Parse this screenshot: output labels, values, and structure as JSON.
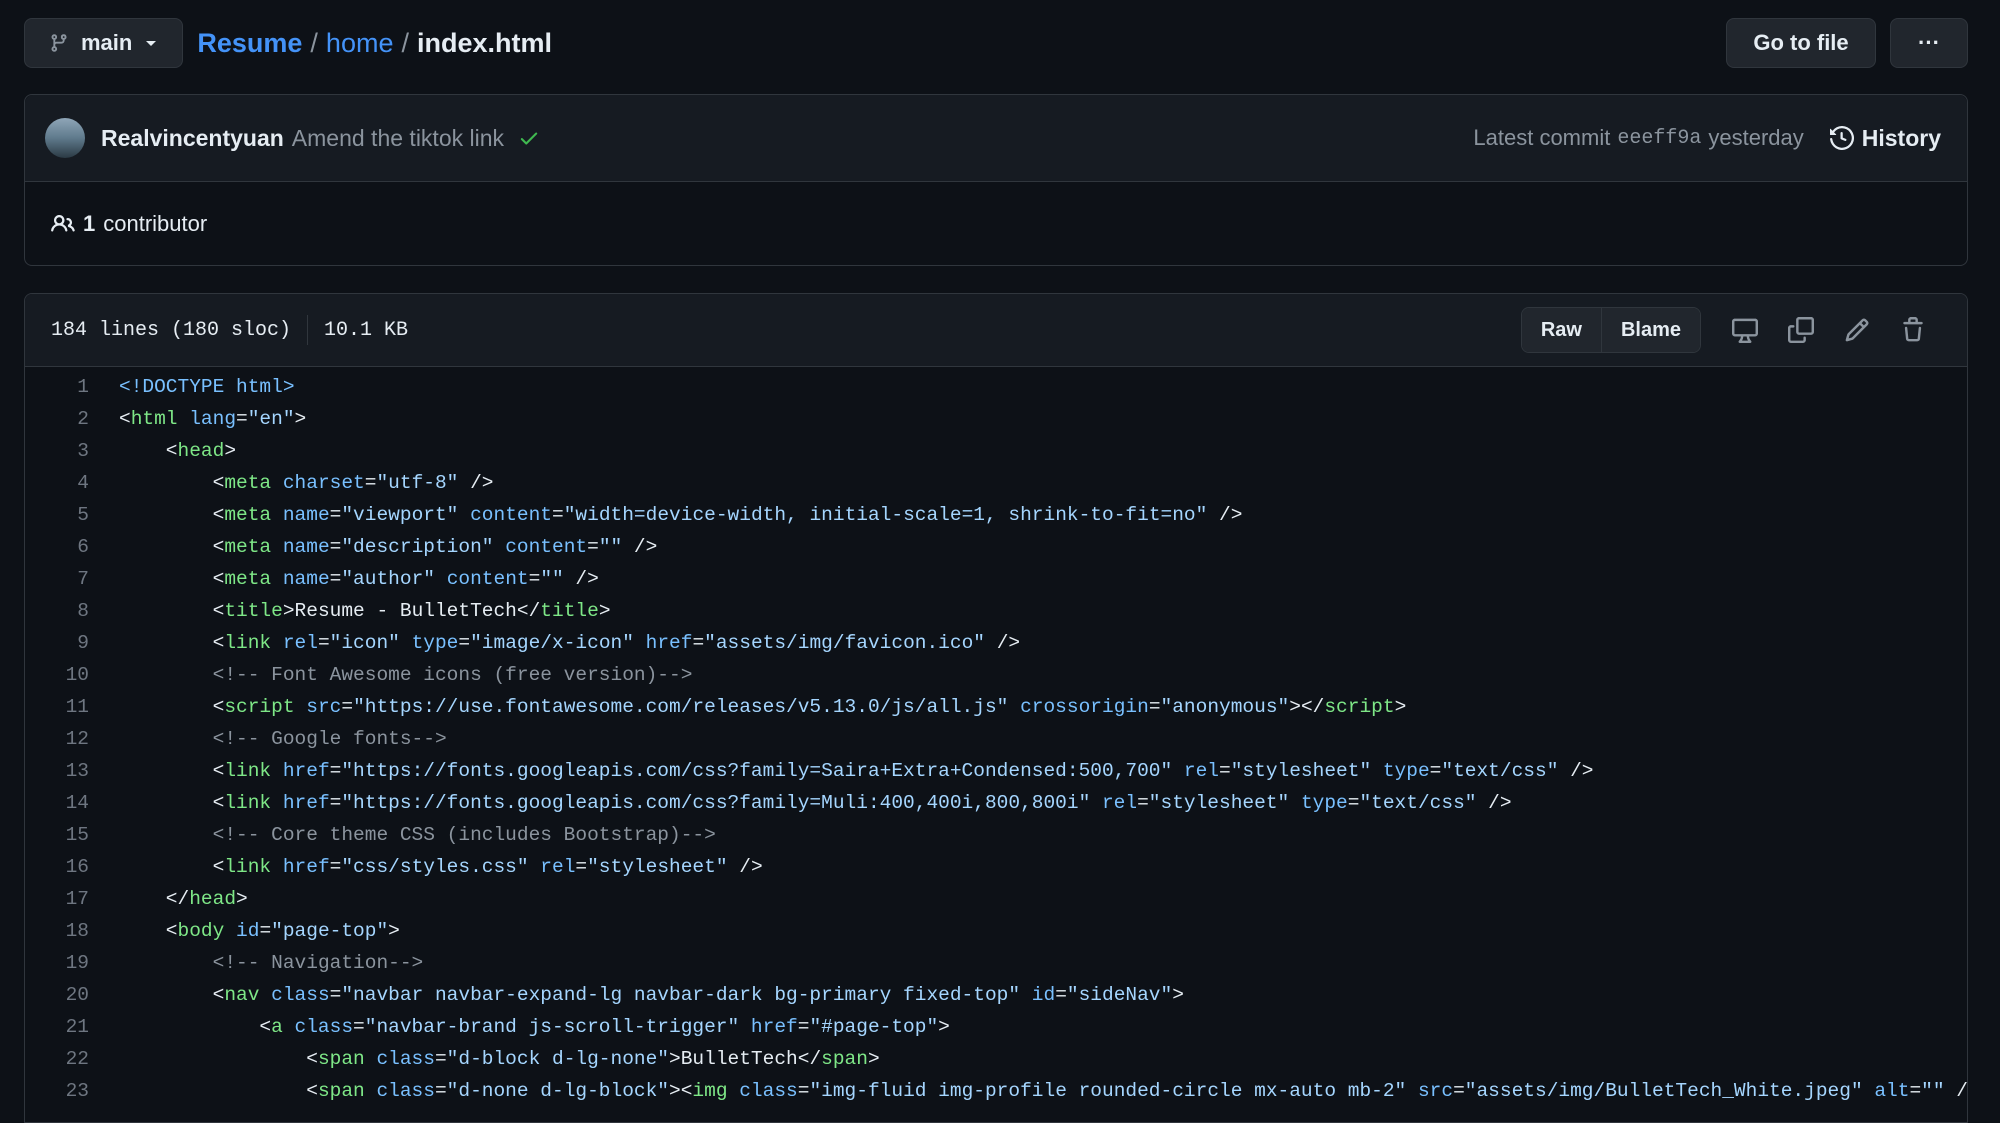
{
  "branch": {
    "name": "main"
  },
  "breadcrumb": {
    "repo": "Resume",
    "sep1": "/",
    "folder": "home",
    "sep2": "/",
    "file": "index.html"
  },
  "buttons": {
    "goto": "Go to file",
    "more": "···"
  },
  "commit": {
    "author": "Realvincentyuan",
    "message": "Amend the tiktok link",
    "status": "✓",
    "latest_label": "Latest commit",
    "sha": "eeeff9a",
    "time": "yesterday",
    "history": "History"
  },
  "contributors": {
    "count": "1",
    "label": "contributor"
  },
  "file": {
    "lines": "184 lines (180 sloc)",
    "size": "10.1 KB",
    "raw": "Raw",
    "blame": "Blame"
  },
  "colors": {
    "accent": "#4493f8",
    "success": "#3fb950",
    "tag": "#7ee787",
    "attr": "#79c0ff",
    "string": "#a5d6ff",
    "comment": "#8b949e"
  },
  "code_lines": [
    {
      "n": "1",
      "t": [
        [
          "doc",
          "<!DOCTYPE html>"
        ]
      ]
    },
    {
      "n": "2",
      "t": [
        [
          "p",
          "<"
        ],
        [
          "tag",
          "html"
        ],
        [
          "p",
          " "
        ],
        [
          "attr",
          "lang"
        ],
        [
          "p",
          "="
        ],
        [
          "str",
          "\"en\""
        ],
        [
          "p",
          ">"
        ]
      ]
    },
    {
      "n": "3",
      "t": [
        [
          "p",
          "    <"
        ],
        [
          "tag",
          "head"
        ],
        [
          "p",
          ">"
        ]
      ]
    },
    {
      "n": "4",
      "t": [
        [
          "p",
          "        <"
        ],
        [
          "tag",
          "meta"
        ],
        [
          "p",
          " "
        ],
        [
          "attr",
          "charset"
        ],
        [
          "p",
          "="
        ],
        [
          "str",
          "\"utf-8\""
        ],
        [
          "p",
          " />"
        ]
      ]
    },
    {
      "n": "5",
      "t": [
        [
          "p",
          "        <"
        ],
        [
          "tag",
          "meta"
        ],
        [
          "p",
          " "
        ],
        [
          "attr",
          "name"
        ],
        [
          "p",
          "="
        ],
        [
          "str",
          "\"viewport\""
        ],
        [
          "p",
          " "
        ],
        [
          "attr",
          "content"
        ],
        [
          "p",
          "="
        ],
        [
          "str",
          "\"width=device-width, initial-scale=1, shrink-to-fit=no\""
        ],
        [
          "p",
          " />"
        ]
      ]
    },
    {
      "n": "6",
      "t": [
        [
          "p",
          "        <"
        ],
        [
          "tag",
          "meta"
        ],
        [
          "p",
          " "
        ],
        [
          "attr",
          "name"
        ],
        [
          "p",
          "="
        ],
        [
          "str",
          "\"description\""
        ],
        [
          "p",
          " "
        ],
        [
          "attr",
          "content"
        ],
        [
          "p",
          "="
        ],
        [
          "str",
          "\"\""
        ],
        [
          "p",
          " />"
        ]
      ]
    },
    {
      "n": "7",
      "t": [
        [
          "p",
          "        <"
        ],
        [
          "tag",
          "meta"
        ],
        [
          "p",
          " "
        ],
        [
          "attr",
          "name"
        ],
        [
          "p",
          "="
        ],
        [
          "str",
          "\"author\""
        ],
        [
          "p",
          " "
        ],
        [
          "attr",
          "content"
        ],
        [
          "p",
          "="
        ],
        [
          "str",
          "\"\""
        ],
        [
          "p",
          " />"
        ]
      ]
    },
    {
      "n": "8",
      "t": [
        [
          "p",
          "        <"
        ],
        [
          "tag",
          "title"
        ],
        [
          "p",
          ">Resume - BulletTech</"
        ],
        [
          "tag",
          "title"
        ],
        [
          "p",
          ">"
        ]
      ]
    },
    {
      "n": "9",
      "t": [
        [
          "p",
          "        <"
        ],
        [
          "tag",
          "link"
        ],
        [
          "p",
          " "
        ],
        [
          "attr",
          "rel"
        ],
        [
          "p",
          "="
        ],
        [
          "str",
          "\"icon\""
        ],
        [
          "p",
          " "
        ],
        [
          "attr",
          "type"
        ],
        [
          "p",
          "="
        ],
        [
          "str",
          "\"image/x-icon\""
        ],
        [
          "p",
          " "
        ],
        [
          "attr",
          "href"
        ],
        [
          "p",
          "="
        ],
        [
          "str",
          "\"assets/img/favicon.ico\""
        ],
        [
          "p",
          " />"
        ]
      ]
    },
    {
      "n": "10",
      "t": [
        [
          "p",
          "        "
        ],
        [
          "com",
          "<!-- Font Awesome icons (free version)-->"
        ]
      ]
    },
    {
      "n": "11",
      "t": [
        [
          "p",
          "        <"
        ],
        [
          "tag",
          "script"
        ],
        [
          "p",
          " "
        ],
        [
          "attr",
          "src"
        ],
        [
          "p",
          "="
        ],
        [
          "str",
          "\"https://use.fontawesome.com/releases/v5.13.0/js/all.js\""
        ],
        [
          "p",
          " "
        ],
        [
          "attr",
          "crossorigin"
        ],
        [
          "p",
          "="
        ],
        [
          "str",
          "\"anonymous\""
        ],
        [
          "p",
          "></"
        ],
        [
          "tag",
          "script"
        ],
        [
          "p",
          ">"
        ]
      ]
    },
    {
      "n": "12",
      "t": [
        [
          "p",
          "        "
        ],
        [
          "com",
          "<!-- Google fonts-->"
        ]
      ]
    },
    {
      "n": "13",
      "t": [
        [
          "p",
          "        <"
        ],
        [
          "tag",
          "link"
        ],
        [
          "p",
          " "
        ],
        [
          "attr",
          "href"
        ],
        [
          "p",
          "="
        ],
        [
          "str",
          "\"https://fonts.googleapis.com/css?family=Saira+Extra+Condensed:500,700\""
        ],
        [
          "p",
          " "
        ],
        [
          "attr",
          "rel"
        ],
        [
          "p",
          "="
        ],
        [
          "str",
          "\"stylesheet\""
        ],
        [
          "p",
          " "
        ],
        [
          "attr",
          "type"
        ],
        [
          "p",
          "="
        ],
        [
          "str",
          "\"text/css\""
        ],
        [
          "p",
          " />"
        ]
      ]
    },
    {
      "n": "14",
      "t": [
        [
          "p",
          "        <"
        ],
        [
          "tag",
          "link"
        ],
        [
          "p",
          " "
        ],
        [
          "attr",
          "href"
        ],
        [
          "p",
          "="
        ],
        [
          "str",
          "\"https://fonts.googleapis.com/css?family=Muli:400,400i,800,800i\""
        ],
        [
          "p",
          " "
        ],
        [
          "attr",
          "rel"
        ],
        [
          "p",
          "="
        ],
        [
          "str",
          "\"stylesheet\""
        ],
        [
          "p",
          " "
        ],
        [
          "attr",
          "type"
        ],
        [
          "p",
          "="
        ],
        [
          "str",
          "\"text/css\""
        ],
        [
          "p",
          " />"
        ]
      ]
    },
    {
      "n": "15",
      "t": [
        [
          "p",
          "        "
        ],
        [
          "com",
          "<!-- Core theme CSS (includes Bootstrap)-->"
        ]
      ]
    },
    {
      "n": "16",
      "t": [
        [
          "p",
          "        <"
        ],
        [
          "tag",
          "link"
        ],
        [
          "p",
          " "
        ],
        [
          "attr",
          "href"
        ],
        [
          "p",
          "="
        ],
        [
          "str",
          "\"css/styles.css\""
        ],
        [
          "p",
          " "
        ],
        [
          "attr",
          "rel"
        ],
        [
          "p",
          "="
        ],
        [
          "str",
          "\"stylesheet\""
        ],
        [
          "p",
          " />"
        ]
      ]
    },
    {
      "n": "17",
      "t": [
        [
          "p",
          "    </"
        ],
        [
          "tag",
          "head"
        ],
        [
          "p",
          ">"
        ]
      ]
    },
    {
      "n": "18",
      "t": [
        [
          "p",
          "    <"
        ],
        [
          "tag",
          "body"
        ],
        [
          "p",
          " "
        ],
        [
          "attr",
          "id"
        ],
        [
          "p",
          "="
        ],
        [
          "str",
          "\"page-top\""
        ],
        [
          "p",
          ">"
        ]
      ]
    },
    {
      "n": "19",
      "t": [
        [
          "p",
          "        "
        ],
        [
          "com",
          "<!-- Navigation-->"
        ]
      ]
    },
    {
      "n": "20",
      "t": [
        [
          "p",
          "        <"
        ],
        [
          "tag",
          "nav"
        ],
        [
          "p",
          " "
        ],
        [
          "attr",
          "class"
        ],
        [
          "p",
          "="
        ],
        [
          "str",
          "\"navbar navbar-expand-lg navbar-dark bg-primary fixed-top\""
        ],
        [
          "p",
          " "
        ],
        [
          "attr",
          "id"
        ],
        [
          "p",
          "="
        ],
        [
          "str",
          "\"sideNav\""
        ],
        [
          "p",
          ">"
        ]
      ]
    },
    {
      "n": "21",
      "t": [
        [
          "p",
          "            <"
        ],
        [
          "tag",
          "a"
        ],
        [
          "p",
          " "
        ],
        [
          "attr",
          "class"
        ],
        [
          "p",
          "="
        ],
        [
          "str",
          "\"navbar-brand js-scroll-trigger\""
        ],
        [
          "p",
          " "
        ],
        [
          "attr",
          "href"
        ],
        [
          "p",
          "="
        ],
        [
          "str",
          "\"#page-top\""
        ],
        [
          "p",
          ">"
        ]
      ]
    },
    {
      "n": "22",
      "t": [
        [
          "p",
          "                <"
        ],
        [
          "tag",
          "span"
        ],
        [
          "p",
          " "
        ],
        [
          "attr",
          "class"
        ],
        [
          "p",
          "="
        ],
        [
          "str",
          "\"d-block d-lg-none\""
        ],
        [
          "p",
          ">BulletTech</"
        ],
        [
          "tag",
          "span"
        ],
        [
          "p",
          ">"
        ]
      ]
    },
    {
      "n": "23",
      "t": [
        [
          "p",
          "                <"
        ],
        [
          "tag",
          "span"
        ],
        [
          "p",
          " "
        ],
        [
          "attr",
          "class"
        ],
        [
          "p",
          "="
        ],
        [
          "str",
          "\"d-none d-lg-block\""
        ],
        [
          "p",
          "><"
        ],
        [
          "tag",
          "img"
        ],
        [
          "p",
          " "
        ],
        [
          "attr",
          "class"
        ],
        [
          "p",
          "="
        ],
        [
          "str",
          "\"img-fluid img-profile rounded-circle mx-auto mb-2\""
        ],
        [
          "p",
          " "
        ],
        [
          "attr",
          "src"
        ],
        [
          "p",
          "="
        ],
        [
          "str",
          "\"assets/img/BulletTech_White.jpeg\""
        ],
        [
          "p",
          " "
        ],
        [
          "attr",
          "alt"
        ],
        [
          "p",
          "="
        ],
        [
          "str",
          "\"\""
        ],
        [
          "p",
          " /></"
        ]
      ]
    }
  ]
}
